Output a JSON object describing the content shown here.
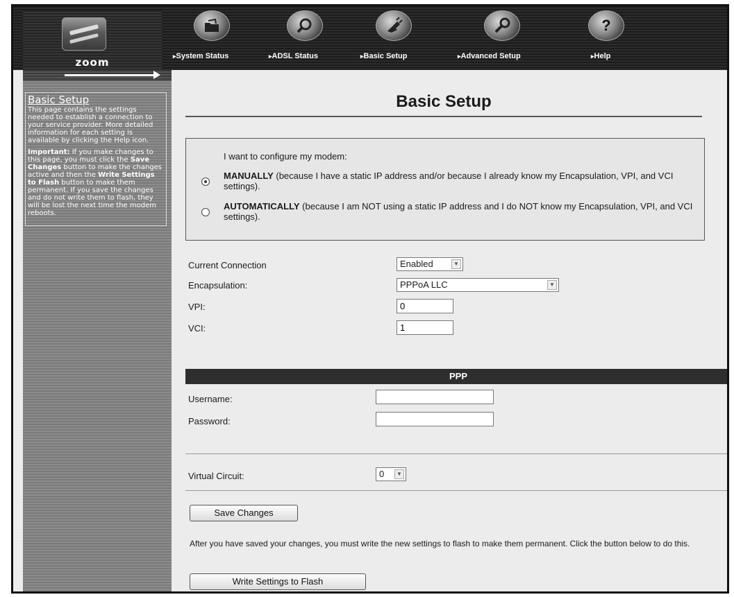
{
  "brand": {
    "logo_text": "zoom"
  },
  "nav": [
    {
      "label": "System Status",
      "icon": "folder-icon"
    },
    {
      "label": "ADSL Status",
      "icon": "magnifier-icon"
    },
    {
      "label": "Basic Setup",
      "icon": "plug-icon"
    },
    {
      "label": "Advanced Setup",
      "icon": "wrench-icon"
    },
    {
      "label": "Help",
      "icon": "question-icon",
      "glyph": "?"
    }
  ],
  "sidebar": {
    "title": "Basic Setup",
    "p1": "This page contains the settings needed to establish a connection to your service provider. More detailed information for each setting is available by clicking the Help icon.",
    "p2_bold1": "Important:",
    "p2_t1": " If you make changes to this page, you must click the ",
    "p2_bold2": "Save Changes",
    "p2_t2": " button to make the changes active and then the ",
    "p2_bold3": "Write Settings to Flash",
    "p2_t3": " button to make them permanent. If you save the changes and do not write them to flash, they will be lost the next time the modem reboots."
  },
  "page": {
    "title": "Basic Setup"
  },
  "mode": {
    "intro": "I want to configure my modem:",
    "manual_bold": "MANUALLY",
    "manual_text": " (because I have a static IP address and/or because I already know my Encapsulation, VPI, and VCI settings).",
    "auto_bold": "AUTOMATICALLY",
    "auto_text": " (because I am NOT using a static IP address and I do NOT know my Encapsulation, VPI, and VCI settings).",
    "selected": "manual"
  },
  "form": {
    "current_connection_label": "Current Connection",
    "current_connection_value": "Enabled",
    "encapsulation_label": "Encapsulation:",
    "encapsulation_value": "PPPoA LLC",
    "vpi_label": "VPI:",
    "vpi_value": "0",
    "vci_label": "VCI:",
    "vci_value": "1"
  },
  "ppp": {
    "header": "PPP",
    "username_label": "Username:",
    "username_value": "",
    "password_label": "Password:",
    "password_value": ""
  },
  "vc": {
    "label": "Virtual Circuit:",
    "value": "0"
  },
  "actions": {
    "save_label": "Save Changes",
    "note": "After you have saved your changes, you must write the new settings to flash to make them permanent. Click the button below to do this.",
    "write_label": "Write Settings to Flash"
  }
}
